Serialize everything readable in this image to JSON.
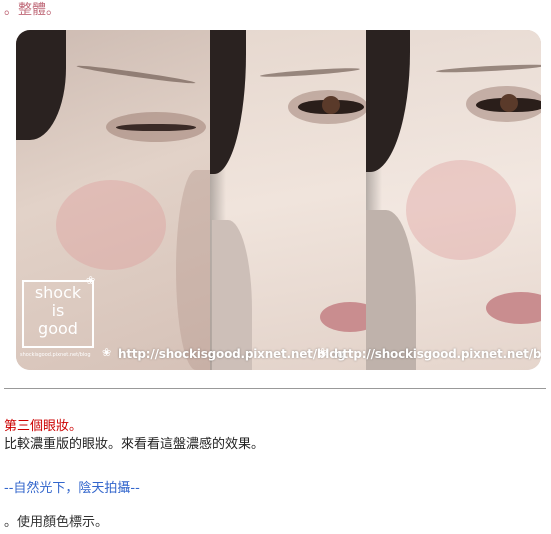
{
  "header": {
    "text": "。整體。"
  },
  "photo": {
    "logo_lines": [
      "shock",
      "is",
      "good"
    ],
    "logo_sub": "shockisgood.pixnet.net/blog",
    "watermarks": [
      "http://shockisgood.pixnet.net/blog",
      "http://shockisgood.pixnet.net/blog"
    ]
  },
  "section": {
    "title": "第三個眼妝。",
    "description": "比較濃重版的眼妝。來看看這盤濃感的效果。",
    "condition": "--自然光下，陰天拍攝--",
    "color_note": "。使用顏色標示。"
  }
}
